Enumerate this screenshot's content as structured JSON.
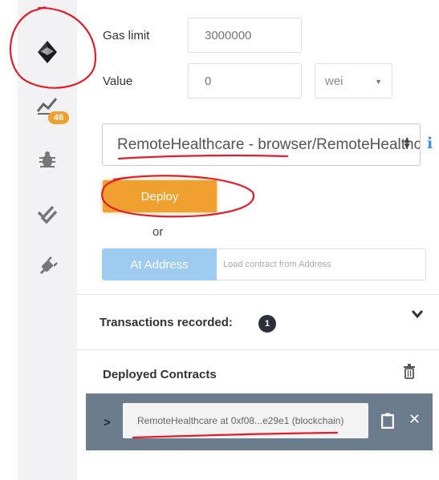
{
  "form": {
    "gas_limit_label": "Gas limit",
    "gas_limit_value": "3000000",
    "value_label": "Value",
    "value_value": "0",
    "value_unit": "wei"
  },
  "sidebar": {
    "badge_count": "46",
    "icons": [
      "ethereum-icon",
      "analytics-icon",
      "debug-bug-icon",
      "test-checks-icon",
      "plugin-icon"
    ]
  },
  "contract": {
    "selected": "RemoteHealthcare - browser/RemoteHealthcare.sol"
  },
  "actions": {
    "deploy_label": "Deploy",
    "or_label": "or",
    "at_address_label": "At Address",
    "address_placeholder": "Load contract from Address"
  },
  "transactions": {
    "label": "Transactions recorded:",
    "count": "1"
  },
  "deployed": {
    "label": "Deployed Contracts",
    "instance_name": "RemoteHealthcare at 0xf08...e29e1 (blockchain)"
  },
  "colors": {
    "deploy": "#f0a02e",
    "at_address": "#9ecbf0",
    "annotation": "#e11d2b",
    "instance_bg": "#6b7c8c",
    "info": "#3a8ee6"
  }
}
